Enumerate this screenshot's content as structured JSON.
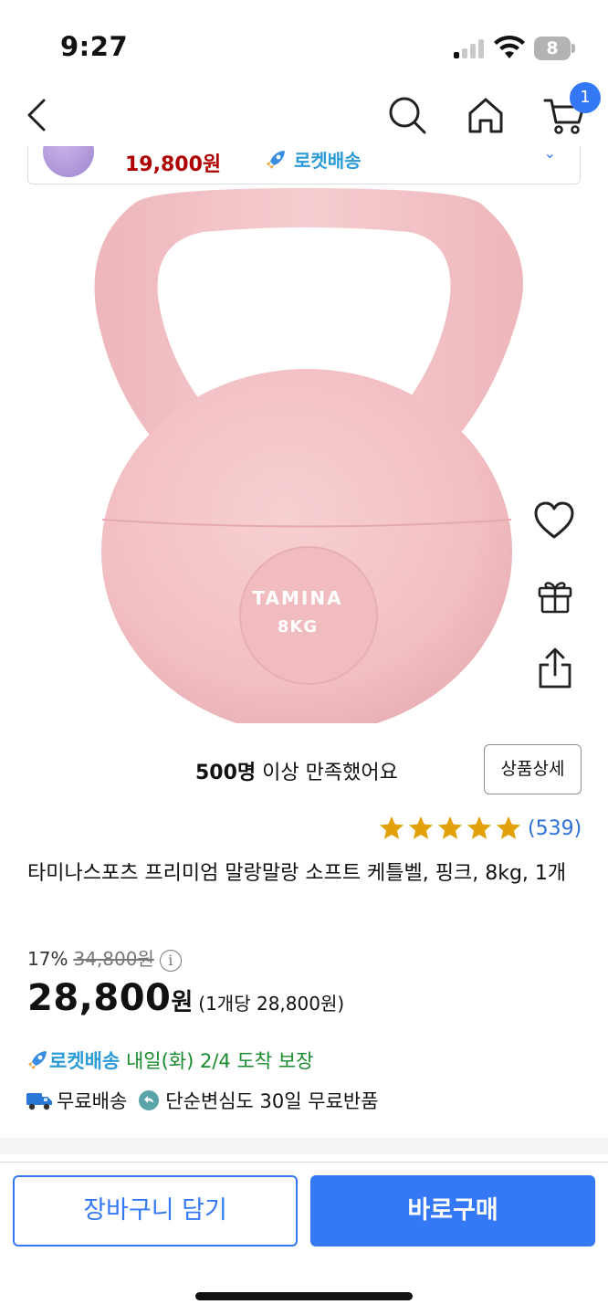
{
  "status_bar": {
    "time": "9:27",
    "battery": "8"
  },
  "nav": {
    "cart_count": "1"
  },
  "mini_banner": {
    "price": "19,800원",
    "rocket_label": "로켓배송"
  },
  "product_image": {
    "brand_text": "TAMINA",
    "weight_text": "8KG",
    "color": "#f3c3c6"
  },
  "satisfaction": {
    "count": "500명",
    "text": " 이상 만족했어요"
  },
  "detail_button": "상품상세",
  "rating": {
    "stars": 5,
    "max": 5,
    "review_count": "(539)"
  },
  "product": {
    "title": "타미나스포츠 프리미엄 말랑말랑 소프트 케틀벨, 핑크, 8kg, 1개",
    "discount": "17%",
    "original_price": "34,800원",
    "price": "28,800",
    "price_unit": "원",
    "unit_price": "(1개당 28,800원)"
  },
  "delivery": {
    "rocket_label": "로켓배송",
    "arrival": " 내일(화) 2/4 도착 보장",
    "free_shipping": "무료배송",
    "free_return": "단순변심도 30일 무료반품"
  },
  "buttons": {
    "add_to_cart": "장바구니 담기",
    "buy_now": "바로구매"
  },
  "colors": {
    "accent": "#3478f6",
    "price_red": "#ae0000",
    "delivery_green": "#178a2e",
    "star": "#e1a10a"
  }
}
